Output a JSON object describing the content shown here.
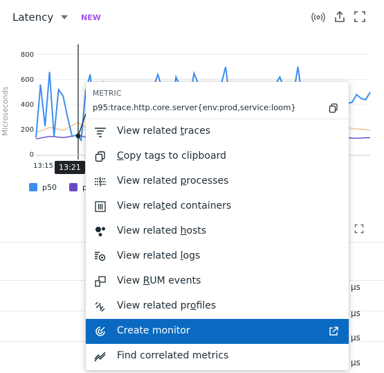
{
  "header": {
    "title": "Latency",
    "badge": "NEW",
    "badge_color": "#a64ff0"
  },
  "chart_data": {
    "type": "line",
    "ylabel": "Microseconds",
    "ylim": [
      0,
      900
    ],
    "y_ticks": [
      "0",
      "200",
      "400",
      "600",
      "800"
    ],
    "x_ticks": [
      "13:15"
    ],
    "hover_time": "13:21",
    "grid": true,
    "series": [
      {
        "name": "p50",
        "color": "#3b8ff0",
        "values": [
          140,
          560,
          230,
          660,
          150,
          520,
          470,
          300,
          150,
          160,
          120,
          510,
          640,
          300,
          570,
          580,
          350,
          230,
          190,
          540,
          230,
          560,
          440,
          400,
          360,
          150,
          540,
          640,
          520,
          420,
          330,
          620,
          540,
          150,
          440,
          650,
          560,
          500,
          460,
          440,
          420,
          560,
          700,
          410,
          400,
          470,
          450,
          520,
          460,
          400,
          360,
          300,
          500,
          560,
          620,
          520,
          380,
          480,
          700,
          440,
          400,
          380,
          450,
          430,
          440,
          500,
          460,
          440,
          430,
          410,
          420,
          480,
          450,
          440,
          500
        ]
      },
      {
        "name": "p90",
        "color": "#6749c4",
        "values": [
          130,
          150,
          140,
          160,
          130,
          140,
          150,
          135,
          140,
          130,
          120,
          140,
          150,
          140,
          130,
          140,
          135,
          140,
          130,
          140,
          150,
          130,
          140,
          135,
          140
        ]
      },
      {
        "name": "p95",
        "color": "#f2c48f",
        "values": [
          180,
          220,
          200,
          260,
          190,
          230,
          210,
          200,
          240,
          190,
          180,
          210,
          230,
          200,
          190,
          220,
          210,
          200,
          230,
          210,
          200,
          190,
          220,
          210,
          200
        ]
      }
    ]
  },
  "legend": [
    "p50",
    "p90"
  ],
  "background_cells": [
    "µs",
    "µs",
    "µs",
    "µs"
  ],
  "menu": {
    "kicker": "METRIC",
    "metric": "p95:trace.http.core.server{env:prod,service:loom}",
    "items": [
      {
        "label": "View related traces",
        "icon": "traces-icon"
      },
      {
        "label": "Copy tags to clipboard",
        "icon": "copy-icon"
      },
      {
        "label": "View related processes",
        "icon": "processes-icon"
      },
      {
        "label": "View related containers",
        "icon": "containers-icon"
      },
      {
        "label": "View related hosts",
        "icon": "hosts-icon"
      },
      {
        "label": "View related logs",
        "icon": "logs-icon"
      },
      {
        "label": "View RUM events",
        "icon": "rum-icon"
      },
      {
        "label": "View related profiles",
        "icon": "profiles-icon"
      },
      {
        "label": "Create monitor",
        "icon": "monitor-icon",
        "active": true
      },
      {
        "label": "Find correlated metrics",
        "icon": "correlated-metrics-icon"
      }
    ],
    "active_color": "#0a6ac1"
  }
}
